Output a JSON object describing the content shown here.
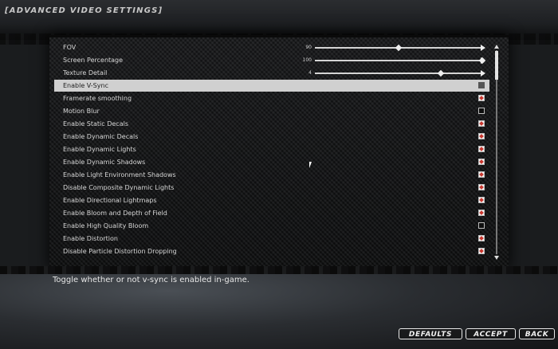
{
  "window": {
    "title": "[ADVANCED VIDEO SETTINGS]"
  },
  "sliders": [
    {
      "label": "FOV",
      "value_text": "90",
      "fraction": 0.5
    },
    {
      "label": "Screen Percentage",
      "value_text": "100",
      "fraction": 1.0
    },
    {
      "label": "Texture Detail",
      "value_text": "4",
      "fraction": 0.75
    }
  ],
  "toggles": [
    {
      "label": "Enable V-Sync",
      "checked": false,
      "selected": true
    },
    {
      "label": "Framerate smoothing",
      "checked": true
    },
    {
      "label": "Motion Blur",
      "checked": false
    },
    {
      "label": "Enable Static Decals",
      "checked": true
    },
    {
      "label": "Enable Dynamic Decals",
      "checked": true
    },
    {
      "label": "Enable Dynamic Lights",
      "checked": true
    },
    {
      "label": "Enable Dynamic Shadows",
      "checked": true
    },
    {
      "label": "Enable Light Environment Shadows",
      "checked": true
    },
    {
      "label": "Disable Composite Dynamic Lights",
      "checked": true
    },
    {
      "label": "Enable Directional Lightmaps",
      "checked": true
    },
    {
      "label": "Enable Bloom and Depth of Field",
      "checked": true
    },
    {
      "label": "Enable High Quality Bloom",
      "checked": false
    },
    {
      "label": "Enable Distortion",
      "checked": true
    },
    {
      "label": "Disable Particle Distortion Dropping",
      "checked": true
    }
  ],
  "description": "Toggle whether or not v-sync is enabled in-game.",
  "buttons": {
    "defaults": "DEFAULTS",
    "accept": "ACCEPT",
    "back": "BACK"
  }
}
